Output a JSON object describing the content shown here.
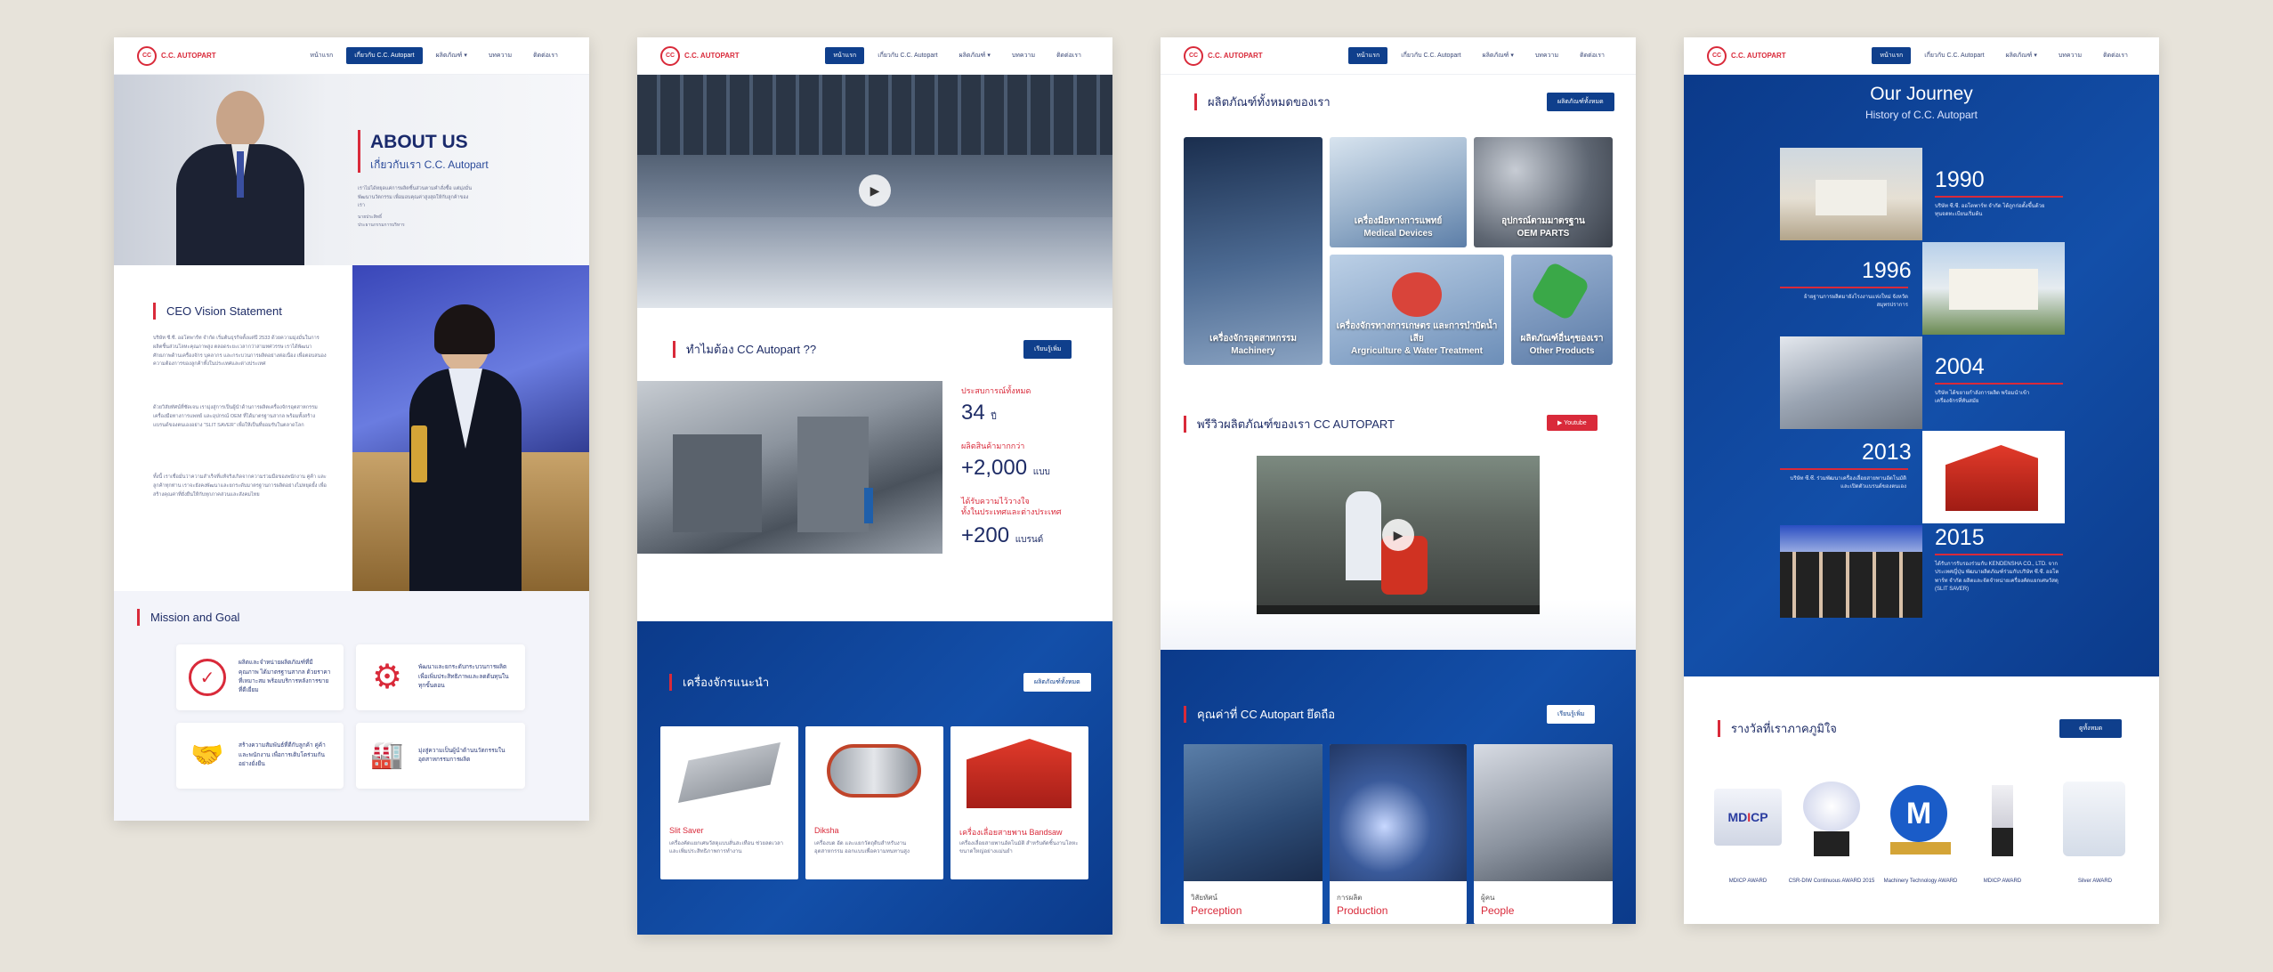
{
  "brand": {
    "logo_text": "C.C. AUTOPART",
    "logo_sub": "",
    "logo_mark": "CC",
    "primary": "#0f3f8c",
    "accent": "#d92a3a"
  },
  "nav": {
    "items": [
      "หน้าแรก",
      "เกี่ยวกับ C.C. Autopart",
      "ผลิตภัณฑ์ ▾",
      "บทความ",
      "ติดต่อเรา"
    ]
  },
  "page1": {
    "hero_title": "ABOUT US",
    "hero_subtitle": "เกี่ยวกับเรา C.C. Autopart",
    "hero_desc": "เราไม่ได้หยุดแค่การผลิตชิ้นส่วนตามคำสั่งซื้อ แต่มุ่งมั่นพัฒนานวัตกรรม เพื่อมอบคุณค่าสูงสุดให้กับลูกค้าของเรา",
    "hero_sign": "นายประสิทธิ์\nประธานกรรมการบริหาร",
    "ceo_title": "CEO Vision Statement",
    "ceo_p1": "บริษัท ซี.ซี. ออโตพาร์ท จำกัด เริ่มต้นธุรกิจตั้งแต่ปี 2533 ด้วยความมุ่งมั่นในการผลิตชิ้นส่วนโลหะคุณภาพสูง ตลอดระยะเวลากว่าสามทศวรรษ เราได้พัฒนาศักยภาพด้านเครื่องจักร บุคลากร และกระบวนการผลิตอย่างต่อเนื่อง เพื่อตอบสนองความต้องการของลูกค้าทั้งในประเทศและต่างประเทศ",
    "ceo_p2": "ด้วยวิสัยทัศน์ที่ชัดเจน เรามุ่งสู่การเป็นผู้นำด้านการผลิตเครื่องจักรอุตสาหกรรม เครื่องมือทางการแพทย์ และอุปกรณ์ OEM ที่ได้มาตรฐานสากล พร้อมทั้งสร้างแบรนด์ของตนเองอย่าง “SLIT SAVER” เพื่อให้เป็นที่ยอมรับในตลาดโลก",
    "ceo_p3": "ทั้งนี้ เราเชื่อมั่นว่าความสำเร็จที่แท้จริงเกิดจากความร่วมมือของพนักงาน คู่ค้า และลูกค้าทุกท่าน เราจะยังคงพัฒนาและยกระดับมาตรฐานการผลิตอย่างไม่หยุดยั้ง เพื่อสร้างคุณค่าที่ยั่งยืนให้กับทุกภาคส่วนและสังคมไทย",
    "mission_title": "Mission and Goal",
    "missions": [
      "ผลิตและจำหน่ายผลิตภัณฑ์ที่มีคุณภาพ ได้มาตรฐานสากล ด้วยราคาที่เหมาะสม พร้อมบริการหลังการขายที่ดีเยี่ยม",
      "พัฒนาและยกระดับกระบวนการผลิต เพื่อเพิ่มประสิทธิภาพและลดต้นทุนในทุกขั้นตอน",
      "สร้างความสัมพันธ์ที่ดีกับลูกค้า คู่ค้า และพนักงาน เพื่อการเติบโตร่วมกันอย่างยั่งยืน",
      "มุ่งสู่ความเป็นผู้นำด้านนวัตกรรมในอุตสาหกรรมการผลิต"
    ]
  },
  "page2": {
    "why_title": "ทำไมต้อง CC Autopart ??",
    "why_button": "เรียนรู้เพิ่ม",
    "stats": [
      {
        "label": "ประสบการณ์ทั้งหมด",
        "value": "34",
        "unit": "ปี"
      },
      {
        "label": "ผลิตสินค้ามากกว่า",
        "value": "+2,000",
        "unit": "แบบ"
      },
      {
        "label": "ได้รับความไว้วางใจ\nทั้งในประเทศและต่างประเทศ",
        "value": "+200",
        "unit": "แบรนด์"
      }
    ],
    "machines_title": "เครื่องจักรแนะนำ",
    "machines_button": "ผลิตภัณฑ์ทั้งหมด",
    "machines": [
      {
        "title": "Slit Saver",
        "desc": "เครื่องคัดแยกเศษวัสดุแบบสั่นสะเทือน ช่วยลดเวลาและเพิ่มประสิทธิภาพการทำงาน"
      },
      {
        "title": "Diksha",
        "desc": "เครื่องบด อัด และแยกวัตถุดิบสำหรับงานอุตสาหกรรม ออกแบบเพื่อความทนทานสูง"
      },
      {
        "title": "เครื่องเลื่อยสายพาน Bandsaw",
        "desc": "เครื่องเลื่อยสายพานอัตโนมัติ สำหรับตัดชิ้นงานโลหะขนาดใหญ่อย่างแม่นยำ"
      }
    ]
  },
  "page3": {
    "products_title": "ผลิตภัณฑ์ทั้งหมดของเรา",
    "products_button": "ผลิตภัณฑ์ทั้งหมด",
    "products": [
      {
        "th": "เครื่องจักรอุตสาหกรรม",
        "en": "Machinery"
      },
      {
        "th": "เครื่องมือทางการแพทย์",
        "en": "Medical Devices"
      },
      {
        "th": "อุปกรณ์ตามมาตรฐาน",
        "en": "OEM PARTS"
      },
      {
        "th": "เครื่องจักรทางการเกษตร และการบำบัดน้ำเสีย",
        "en": "Argriculture & Water Treatment"
      },
      {
        "th": "ผลิตภัณฑ์อื่นๆของเรา",
        "en": "Other Products"
      }
    ],
    "review_title": "พรีวิวผลิตภัณฑ์ของเรา CC AUTOPART",
    "youtube_button": "Youtube",
    "values_title": "คุณค่าที่ CC Autopart ยึดถือ",
    "values_button": "เรียนรู้เพิ่ม",
    "values": [
      {
        "th": "วิสัยทัศน์",
        "en": "Perception"
      },
      {
        "th": "การผลิต",
        "en": "Production"
      },
      {
        "th": "ผู้คน",
        "en": "People"
      }
    ]
  },
  "page4": {
    "journey_title": "Our Journey",
    "journey_subtitle": "History of C.C. Autopart",
    "timeline": [
      {
        "year": "1990",
        "desc": "บริษัท ซี.ซี. ออโตพาร์ท จำกัด ได้ถูกก่อตั้งขึ้นด้วยทุนจดทะเบียนเริ่มต้น"
      },
      {
        "year": "1996",
        "desc": "ย้ายฐานการผลิตมายังโรงงานแห่งใหม่ จังหวัดสมุทรปราการ"
      },
      {
        "year": "2004",
        "desc": "บริษัท ได้ขยายกำลังการผลิต พร้อมนำเข้าเครื่องจักรที่ทันสมัย"
      },
      {
        "year": "2013",
        "desc": "บริษัท ซี.ซี. ร่วมพัฒนาเครื่องเลื่อยสายพานอัตโนมัติ และเปิดตัวแบรนด์ของตนเอง"
      },
      {
        "year": "2015",
        "desc": "ได้รับการรับรองร่วมกับ KENDENSHA CO., LTD. จากประเทศญี่ปุ่น พัฒนาผลิตภัณฑ์ร่วมกับบริษัท ซี.ซี. ออโตพาร์ท จำกัด ผลิตและจัดจำหน่ายเครื่องคัดแยกเศษวัสดุ (SLIT SAVER)"
      }
    ],
    "awards_title": "รางวัลที่เราภาคภูมิใจ",
    "awards_button": "ดูทั้งหมด",
    "awards": [
      "MDICP AWARD",
      "CSR-DIW Continuous AWARD 2015",
      "Machinery Technology AWARD",
      "MDICP AWARD",
      "Silver AWARD"
    ]
  }
}
